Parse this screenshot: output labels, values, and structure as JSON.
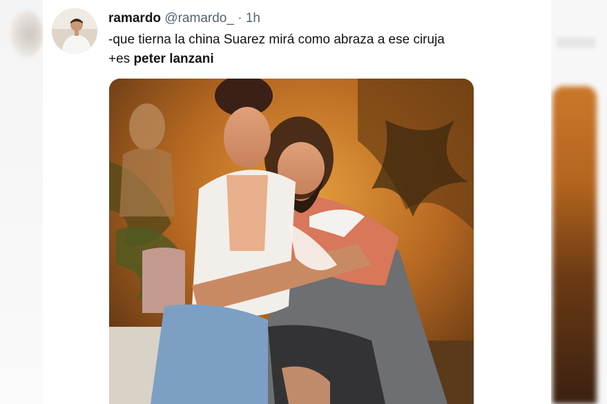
{
  "tweet": {
    "author": {
      "display_name": "ramardo",
      "handle": "@ramardo_",
      "separator": "·",
      "time": "1h"
    },
    "text": {
      "line1": "-que tierna la china Suarez mirá como abraza a ese ciruja",
      "line2_prefix": "+es ",
      "line2_bold": "peter lanzani"
    },
    "media": {
      "type": "photo"
    }
  },
  "colors": {
    "text_primary": "#0f1419",
    "text_secondary": "#536471",
    "background": "#ffffff"
  }
}
